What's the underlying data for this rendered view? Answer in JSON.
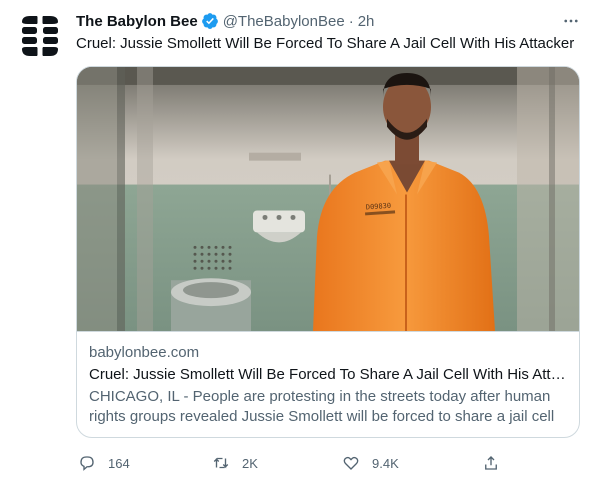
{
  "tweet": {
    "author_name": "The Babylon Bee",
    "handle": "@TheBabylonBee",
    "separator": "·",
    "time": "2h",
    "text": "Cruel: Jussie Smollett Will Be Forced To Share A Jail Cell With His Attacker"
  },
  "card": {
    "domain": "babylonbee.com",
    "title": "Cruel: Jussie Smollett Will Be Forced To Share A Jail Cell With His Atta...",
    "description": "CHICAGO, IL - People are protesting in the streets today after human rights groups revealed Jussie Smollett will be forced to share a jail cell ...",
    "jumpsuit_text": "D09830"
  },
  "actions": {
    "replies": "164",
    "retweets": "2K",
    "likes": "9.4K"
  },
  "colors": {
    "verified": "#1d9bf0",
    "secondary_text": "#536471",
    "brand_yellow": "#f4c020",
    "jumpsuit": "#f58a2a"
  },
  "icons": [
    "bee-logo-icon",
    "verified-badge-icon",
    "more-icon",
    "reply-icon",
    "retweet-icon",
    "like-icon",
    "share-icon"
  ]
}
